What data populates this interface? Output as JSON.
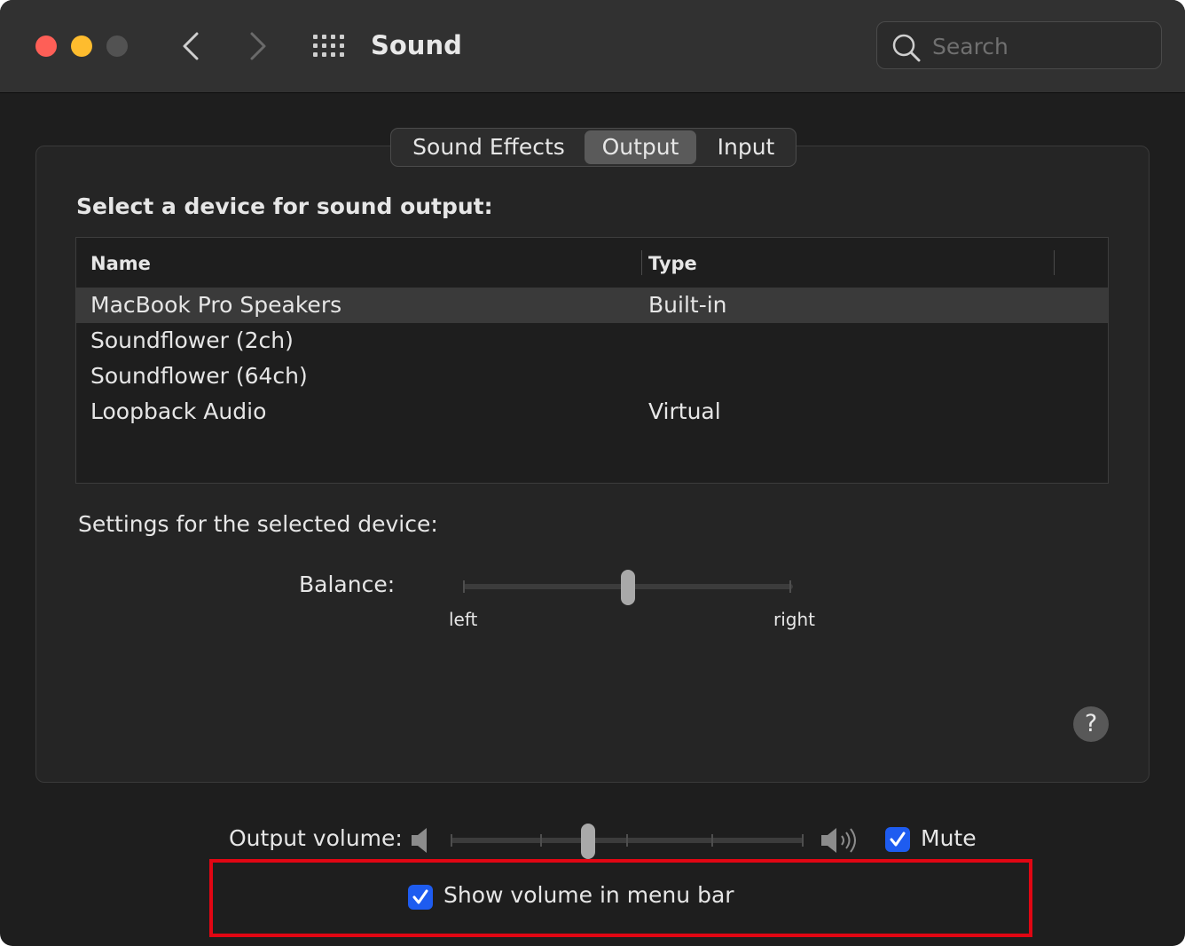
{
  "window": {
    "title": "Sound"
  },
  "search": {
    "placeholder": "Search",
    "icon": "search-icon"
  },
  "tabs": [
    {
      "label": "Sound Effects",
      "selected": false
    },
    {
      "label": "Output",
      "selected": true
    },
    {
      "label": "Input",
      "selected": false
    }
  ],
  "output": {
    "section_title": "Select a device for sound output:",
    "columns": {
      "name": "Name",
      "type": "Type"
    },
    "devices": [
      {
        "name": "MacBook Pro Speakers",
        "type": "Built-in",
        "selected": true
      },
      {
        "name": "Soundflower (2ch)",
        "type": "",
        "selected": false
      },
      {
        "name": "Soundflower (64ch)",
        "type": "",
        "selected": false
      },
      {
        "name": "Loopback Audio",
        "type": "Virtual",
        "selected": false
      }
    ],
    "settings_label": "Settings for the selected device:",
    "balance": {
      "label": "Balance:",
      "left": "left",
      "right": "right",
      "value": 0.5
    }
  },
  "help": {
    "label": "?"
  },
  "volume": {
    "label": "Output volume:",
    "level": 0.39,
    "mute_label": "Mute",
    "mute_checked": true
  },
  "menubar": {
    "label": "Show volume in menu bar",
    "checked": true
  },
  "colors": {
    "accent": "#1e5cf0",
    "close": "#fe5f57",
    "minimize": "#febc2e",
    "highlight_border": "#e10613"
  }
}
